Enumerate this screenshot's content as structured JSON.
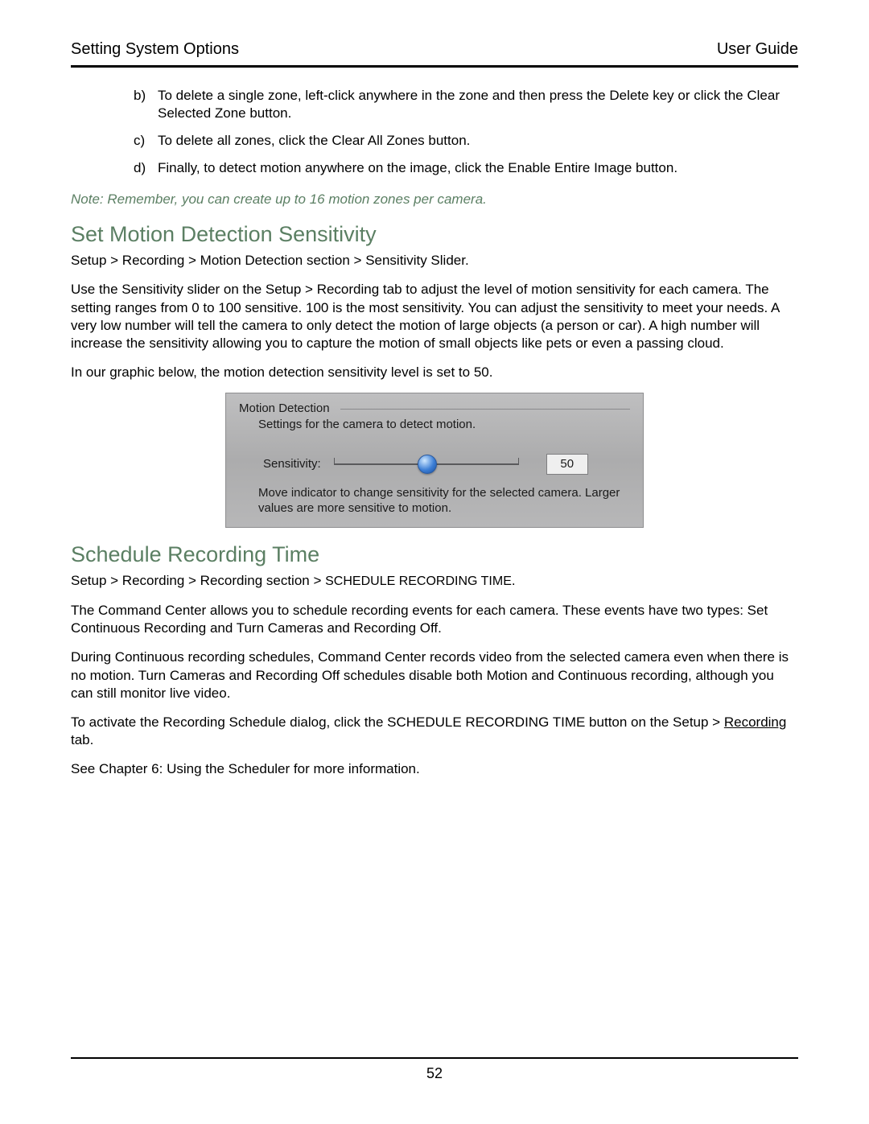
{
  "header": {
    "left": "Setting System Options",
    "right": "User Guide"
  },
  "list": {
    "b": {
      "marker": "b)",
      "text": "To delete a single zone, left-click anywhere in the zone and then press the Delete key or click the Clear Selected Zone button."
    },
    "c": {
      "marker": "c)",
      "text": "To delete all zones, click the Clear All Zones button."
    },
    "d": {
      "marker": "d)",
      "text": "Finally, to detect motion anywhere on the image, click the Enable Entire Image button."
    }
  },
  "note": "Note: Remember, you can create up to 16 motion zones per camera.",
  "sec1": {
    "title": "Set Motion Detection Sensitivity",
    "path": "Setup > Recording > Motion Detection section > Sensitivity Slider.",
    "p1": "Use the Sensitivity slider on the Setup > Recording tab to adjust the level of motion sensitivity for each camera. The setting ranges from 0 to 100 sensitive. 100 is the most sensitivity.  You can adjust the sensitivity to meet your needs. A very low number will tell the camera to only detect the motion of large objects (a person or car). A high number will increase the sensitivity allowing you to capture the motion of small objects like pets or even a passing cloud.",
    "p2": "In our graphic below, the motion detection sensitivity level is set to 50."
  },
  "panel": {
    "title": "Motion Detection",
    "subtitle": "Settings for the camera to detect motion.",
    "slider_label": "Sensitivity:",
    "value": "50",
    "help": "Move indicator to change sensitivity for the selected camera. Larger values are more sensitive to motion."
  },
  "sec2": {
    "title": "Schedule Recording Time",
    "path_pre": "Setup > Recording > Recording section > ",
    "path_caps": "SCHEDULE RECORDING TIME",
    "path_post": ".",
    "p1": "The Command Center allows you to schedule recording events for each camera. These events have two types: Set Continuous Recording and Turn Cameras and Recording Off.",
    "p2": "During Continuous recording schedules, Command Center records video from the selected camera even when there is no motion. Turn Cameras and Recording Off schedules disable both Motion and Continuous recording, although you can still monitor live video.",
    "p3_pre": "To activate the Recording Schedule dialog, click the SCHEDULE RECORDING TIME button on the Setup > ",
    "p3_link": "Recording",
    "p3_post": " tab.",
    "p4": "See Chapter 6: Using the Scheduler for more information."
  },
  "page_number": "52"
}
